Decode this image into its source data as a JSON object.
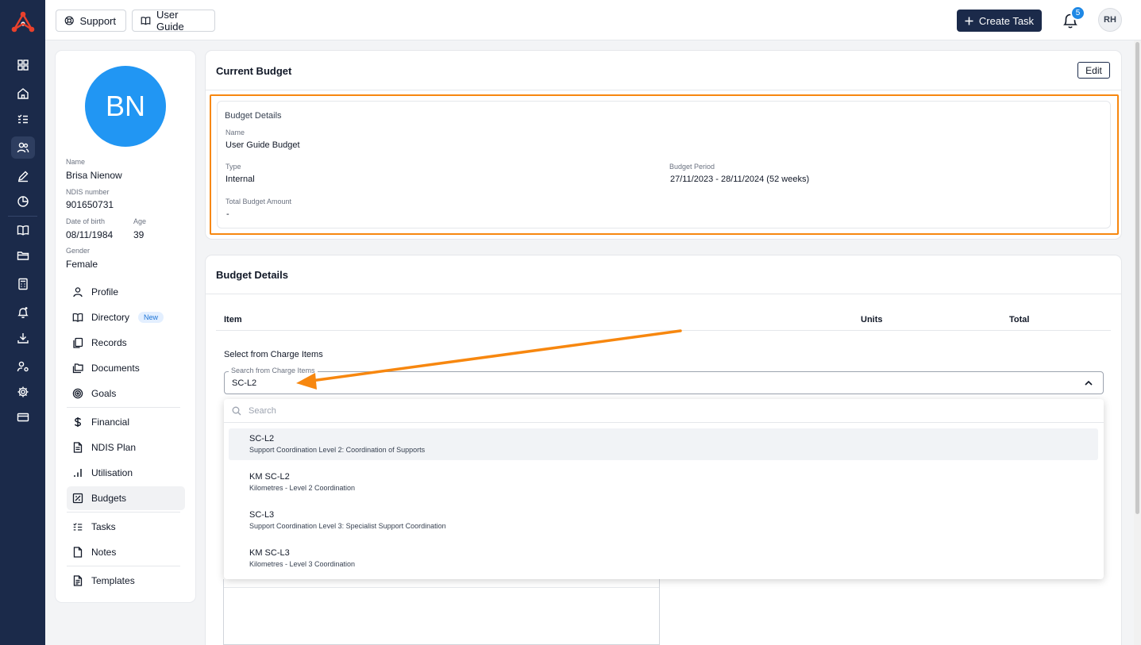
{
  "topbar": {
    "support_label": "Support",
    "user_guide_label": "User Guide",
    "create_task_label": "Create Task",
    "notification_count": "5",
    "user_initials": "RH"
  },
  "rail": {
    "icons": [
      "dashboard-icon",
      "home-icon",
      "checklist-icon",
      "users-icon",
      "pen-icon",
      "pie-chart-icon",
      "book-icon",
      "folder-icon",
      "calculator-icon",
      "bell-plus-icon",
      "download-icon",
      "user-cog-icon",
      "gear-icon",
      "credit-card-icon"
    ],
    "active_index": 3
  },
  "profile": {
    "initials": "BN",
    "name_label": "Name",
    "name": "Brisa Nienow",
    "ndis_label": "NDIS number",
    "ndis": "901650731",
    "dob_label": "Date of birth",
    "dob": "08/11/1984",
    "age_label": "Age",
    "age": "39",
    "gender_label": "Gender",
    "gender": "Female",
    "menu": [
      {
        "label": "Profile",
        "icon": "person-icon"
      },
      {
        "label": "Directory",
        "icon": "book-icon",
        "badge": "New"
      },
      {
        "label": "Records",
        "icon": "copy-icon"
      },
      {
        "label": "Documents",
        "icon": "folders-icon"
      },
      {
        "label": "Goals",
        "icon": "target-icon"
      },
      {
        "label": "Financial",
        "icon": "dollar-icon"
      },
      {
        "label": "NDIS Plan",
        "icon": "document-icon"
      },
      {
        "label": "Utilisation",
        "icon": "bar-chart-icon"
      },
      {
        "label": "Budgets",
        "icon": "budget-icon"
      },
      {
        "label": "Tasks",
        "icon": "checklist-icon"
      },
      {
        "label": "Notes",
        "icon": "note-icon"
      },
      {
        "label": "Templates",
        "icon": "template-icon"
      }
    ],
    "active_menu": "Budgets"
  },
  "current_budget": {
    "title": "Current Budget",
    "edit_label": "Edit",
    "details_heading": "Budget Details",
    "name_label": "Name",
    "name": "User Guide Budget",
    "type_label": "Type",
    "type": "Internal",
    "period_label": "Budget Period",
    "period": "27/11/2023 - 28/11/2024 (52 weeks)",
    "total_label": "Total Budget Amount",
    "total": "-"
  },
  "budget_details": {
    "title": "Budget Details",
    "columns": [
      "Item",
      "Units",
      "Total"
    ],
    "select_label": "Select from Charge Items",
    "combo_legend": "Search from Charge Items",
    "combo_value": "SC-L2",
    "search_placeholder": "Search",
    "options": [
      {
        "code": "SC-L2",
        "desc": "Support Coordination Level 2: Coordination of Supports"
      },
      {
        "code": "KM SC-L2",
        "desc": "Kilometres - Level 2 Coordination"
      },
      {
        "code": "SC-L3",
        "desc": "Support Coordination Level 3: Specialist Support Coordination"
      },
      {
        "code": "KM SC-L3",
        "desc": "Kilometres - Level 3 Coordination"
      }
    ],
    "highlighted_index": 0
  },
  "colors": {
    "navy": "#1b2a4a",
    "accent_blue": "#2196f3",
    "annotation_orange": "#f7870f",
    "logo_red": "#e8412c"
  }
}
